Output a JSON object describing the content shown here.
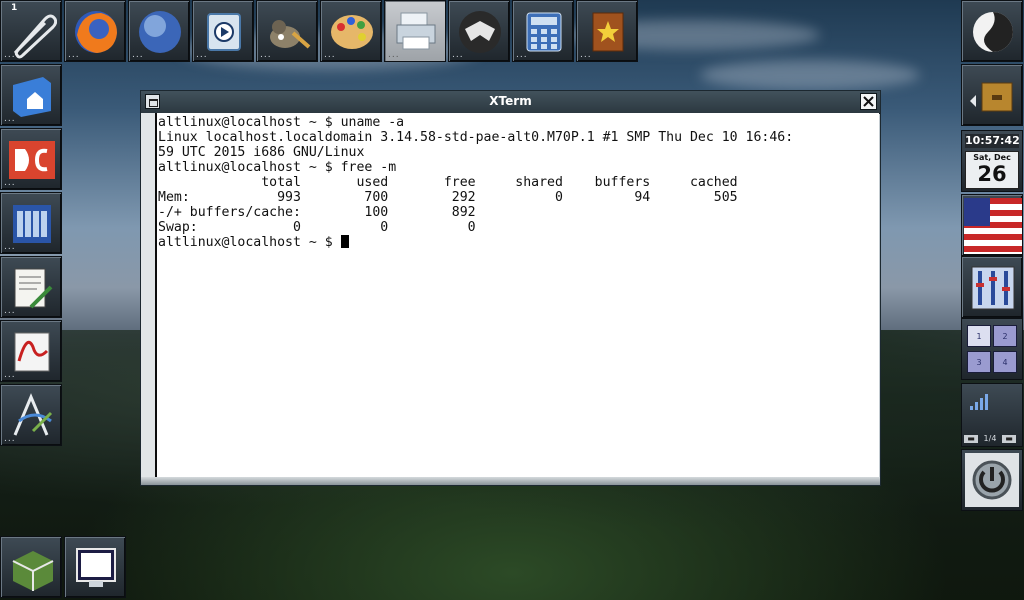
{
  "desktop": {
    "pager_number": "1"
  },
  "xterm": {
    "title": "XTerm",
    "lines": [
      "altlinux@localhost ~ $ uname -a",
      "Linux localhost.localdomain 3.14.58-std-pae-alt0.M70P.1 #1 SMP Thu Dec 10 16:46:",
      "59 UTC 2015 i686 GNU/Linux",
      "altlinux@localhost ~ $ free -m",
      "             total       used       free     shared    buffers     cached",
      "Mem:           993        700        292          0         94        505",
      "-/+ buffers/cache:        100        892",
      "Swap:            0          0          0"
    ],
    "prompt": "altlinux@localhost ~ $ "
  },
  "clock": {
    "time": "10:57:42",
    "day": "Sat, Dec",
    "date": "26"
  },
  "pager": {
    "cells": [
      "1",
      "2",
      "3",
      "4"
    ]
  },
  "netmon": {
    "page": "1/4"
  },
  "icons": {
    "top": [
      "paperclip-icon",
      "firefox-icon",
      "globe-icon",
      "media-player-icon",
      "gimp-icon",
      "paint-palette-icon",
      "printer-icon",
      "moth-icon",
      "calculator-icon",
      "bookmark-book-icon"
    ],
    "left": [
      "home-folder-icon",
      "document-viewer-icon",
      "file-manager-icon",
      "text-editor-icon",
      "pdf-reader-icon",
      "vector-draw-icon"
    ],
    "right": [
      "app-launcher-icon",
      "drawer-icon",
      "us-flag-icon",
      "mixer-icon",
      "network-signal-icon",
      "power-icon"
    ],
    "bottom": [
      "cube-icon",
      "terminal-icon"
    ]
  }
}
